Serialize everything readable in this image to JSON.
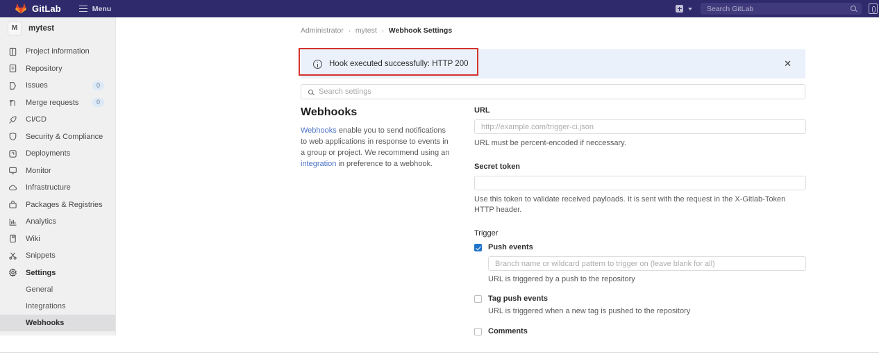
{
  "topbar": {
    "brand": "GitLab",
    "menu_label": "Menu",
    "logo_icon": "gitlab-fox-icon",
    "hamburger_icon": "hamburger-icon",
    "plus_icon": "plus-square-icon",
    "caret_icon": "chevron-down-icon",
    "search_placeholder": "Search GitLab",
    "search_icon": "search-icon",
    "edge_icon": "browser-edge-icon",
    "bg_color": "#2f2a6b"
  },
  "sidebar": {
    "project": {
      "initial": "M",
      "name": "mytest"
    },
    "items": [
      {
        "label": "Project information",
        "icon": "project-info-icon",
        "badge": ""
      },
      {
        "label": "Repository",
        "icon": "repository-icon",
        "badge": ""
      },
      {
        "label": "Issues",
        "icon": "issues-icon",
        "badge": "0"
      },
      {
        "label": "Merge requests",
        "icon": "merge-requests-icon",
        "badge": "0"
      },
      {
        "label": "CI/CD",
        "icon": "rocket-icon",
        "badge": ""
      },
      {
        "label": "Security & Compliance",
        "icon": "shield-icon",
        "badge": ""
      },
      {
        "label": "Deployments",
        "icon": "deployments-icon",
        "badge": ""
      },
      {
        "label": "Monitor",
        "icon": "monitor-icon",
        "badge": ""
      },
      {
        "label": "Infrastructure",
        "icon": "cloud-icon",
        "badge": ""
      },
      {
        "label": "Packages & Registries",
        "icon": "package-icon",
        "badge": ""
      },
      {
        "label": "Analytics",
        "icon": "chart-icon",
        "badge": ""
      },
      {
        "label": "Wiki",
        "icon": "book-icon",
        "badge": ""
      },
      {
        "label": "Snippets",
        "icon": "scissors-icon",
        "badge": ""
      },
      {
        "label": "Settings",
        "icon": "gear-icon",
        "badge": ""
      }
    ],
    "sub_items": [
      {
        "label": "General",
        "active": false
      },
      {
        "label": "Integrations",
        "active": false
      },
      {
        "label": "Webhooks",
        "active": true
      }
    ],
    "badge_color": "#dce9f7"
  },
  "breadcrumb": {
    "root": "Administrator",
    "project": "mytest",
    "current": "Webhook Settings",
    "separator": "›"
  },
  "alert": {
    "message": "Hook executed successfully: HTTP 200",
    "info_icon": "info-circle-icon",
    "close_icon": "close-icon",
    "close_glyph": "✕",
    "bg_color": "#eaf1fa",
    "highlight_color": "#d4332e"
  },
  "search_settings": {
    "placeholder": "Search settings",
    "icon": "search-icon"
  },
  "description": {
    "heading": "Webhooks",
    "link_webhooks": "Webhooks",
    "text_part1": " enable you to send notifications to web applications in response to events in a group or project. We recommend using an ",
    "link_integration": "integration",
    "text_part2": " in preference to a webhook.",
    "link_color": "#4a72c4"
  },
  "form": {
    "url": {
      "label": "URL",
      "placeholder": "http://example.com/trigger-ci.json",
      "value": "",
      "help": "URL must be percent-encoded if neccessary."
    },
    "secret_token": {
      "label": "Secret token",
      "placeholder": "",
      "value": "",
      "help": "Use this token to validate received payloads. It is sent with the request in the X-Gitlab-Token HTTP header."
    },
    "trigger": {
      "heading": "Trigger",
      "options": [
        {
          "label": "Push events",
          "checked": true,
          "input_placeholder": "Branch name or wildcard pattern to trigger on (leave blank for all)",
          "help": "URL is triggered by a push to the repository"
        },
        {
          "label": "Tag push events",
          "checked": false,
          "input_placeholder": "",
          "help": "URL is triggered when a new tag is pushed to the repository"
        },
        {
          "label": "Comments",
          "checked": false,
          "input_placeholder": "",
          "help": ""
        }
      ],
      "checked_color": "#1f75cb"
    }
  }
}
